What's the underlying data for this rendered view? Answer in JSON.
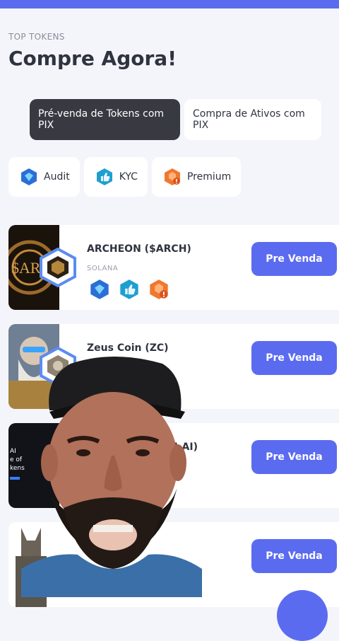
{
  "header": {
    "eyebrow": "TOP TOKENS",
    "title": "Compre Agora!"
  },
  "tabs": [
    {
      "label": "Pré-venda de Tokens com PIX",
      "active": true
    },
    {
      "label": "Compra de Ativos com PIX",
      "active": false
    }
  ],
  "filters": [
    {
      "label": "Audit",
      "icon": "audit-icon"
    },
    {
      "label": "KYC",
      "icon": "kyc-icon"
    },
    {
      "label": "Premium",
      "icon": "premium-icon"
    }
  ],
  "tokens": [
    {
      "name": "ARCHEON ($ARCH)",
      "chain": "SOLANA",
      "button": "Pre Venda"
    },
    {
      "name": "Zeus Coin (ZC)",
      "chain": "",
      "button": "Pre Venda"
    },
    {
      "name": "N-AI)",
      "chain": "",
      "button": "Pre Venda"
    },
    {
      "name": "",
      "chain": "",
      "button": "Pre Venda"
    }
  ],
  "thumbnail_texts": {
    "archeon": "$ARC",
    "third_line1": "AI",
    "third_line2": "e of",
    "third_line3": "kens"
  },
  "colors": {
    "accent": "#5b6bf0",
    "audit": "#2a6fd6",
    "kyc": "#1f9fd0",
    "premium": "#f0782e",
    "active_tab": "#383a42"
  }
}
